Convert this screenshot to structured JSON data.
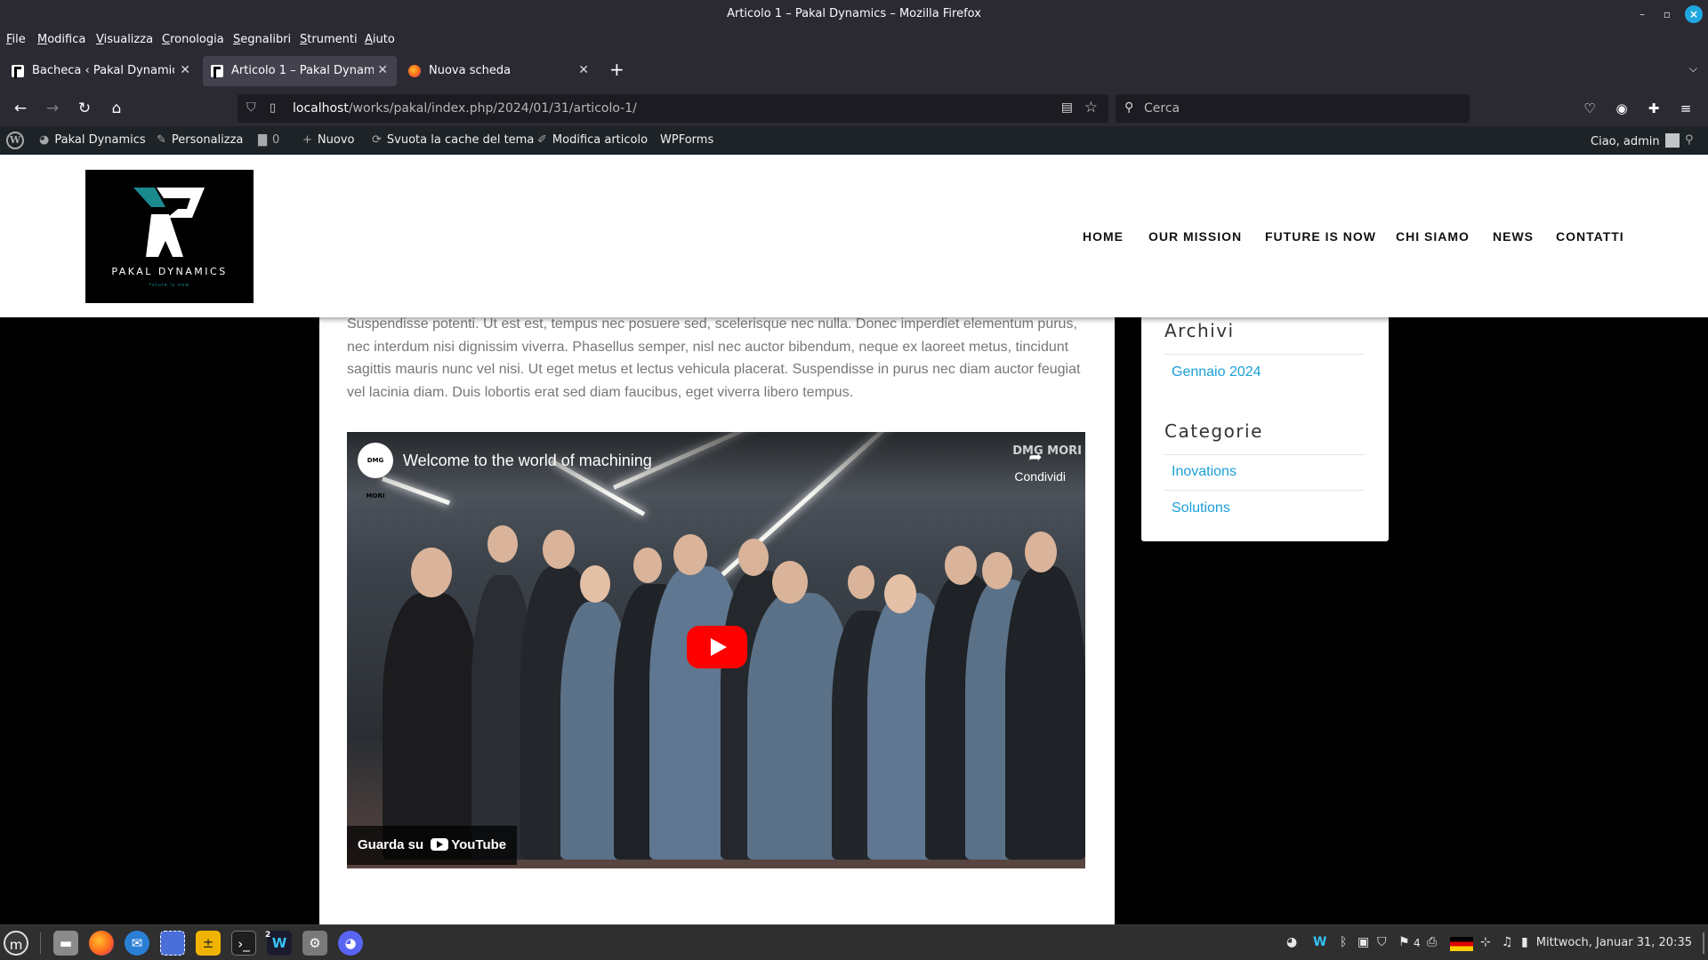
{
  "window": {
    "title": "Articolo 1 – Pakal Dynamics – Mozilla Firefox"
  },
  "menu": [
    "File",
    "Modifica",
    "Visualizza",
    "Cronologia",
    "Segnalibri",
    "Strumenti",
    "Aiuto"
  ],
  "tabs": [
    {
      "label": "Bacheca ‹ Pakal Dynamics —",
      "active": false
    },
    {
      "label": "Articolo 1 – Pakal Dynamics",
      "active": true
    },
    {
      "label": "Nuova scheda",
      "active": false
    }
  ],
  "address": {
    "host": "localhost",
    "path": "/works/pakal/index.php/2024/01/31/articolo-1/"
  },
  "search": {
    "placeholder": "Cerca"
  },
  "adminbar": {
    "site": "Pakal Dynamics",
    "customize": "Personalizza",
    "comments": "0",
    "new": "Nuovo",
    "cache": "Svuota la cache del tema",
    "edit": "Modifica articolo",
    "forms": "WPForms",
    "greeting": "Ciao, admin"
  },
  "logo": {
    "name": "PAKAL DYNAMICS",
    "tagline": "future is now"
  },
  "nav": [
    "HOME",
    "OUR MISSION",
    "FUTURE IS NOW",
    "CHI SIAMO",
    "NEWS",
    "CONTATTI"
  ],
  "article": {
    "paragraph": "Suspendisse potenti. Ut est est, tempus nec posuere sed, scelerisque nec nulla. Donec imperdiet elementum purus, nec interdum nisi dignissim viverra. Phasellus semper, nisl nec auctor bibendum, neque ex laoreet metus, tincidunt sagittis mauris nunc vel nisi. Ut eget metus et lectus vehicula placerat. Suspendisse in purus nec diam auctor feugiat vel lacinia diam. Duis lobortis erat sed diam faucibus, eget viverra libero tempus."
  },
  "video": {
    "channel": "DMG MORI",
    "title": "Welcome to the world of machining",
    "brand": "DMG MORI",
    "share": "Condividi",
    "watch": "Guarda su",
    "watch_brand": "YouTube"
  },
  "sidebar": {
    "archives_title": "Archivi",
    "archives": [
      "Gennaio 2024"
    ],
    "categories_title": "Categorie",
    "categories": [
      "Inovations",
      "Solutions"
    ]
  },
  "taskbar": {
    "workspace_badge": "2",
    "tray_count": "4",
    "clock": "Mittwoch, Januar 31, 20:35"
  },
  "colors": {
    "chrome": "#2b2a33",
    "adminbar": "#1d2327",
    "link": "#1a9fd8",
    "accent_teal": "#1a8a8f"
  }
}
